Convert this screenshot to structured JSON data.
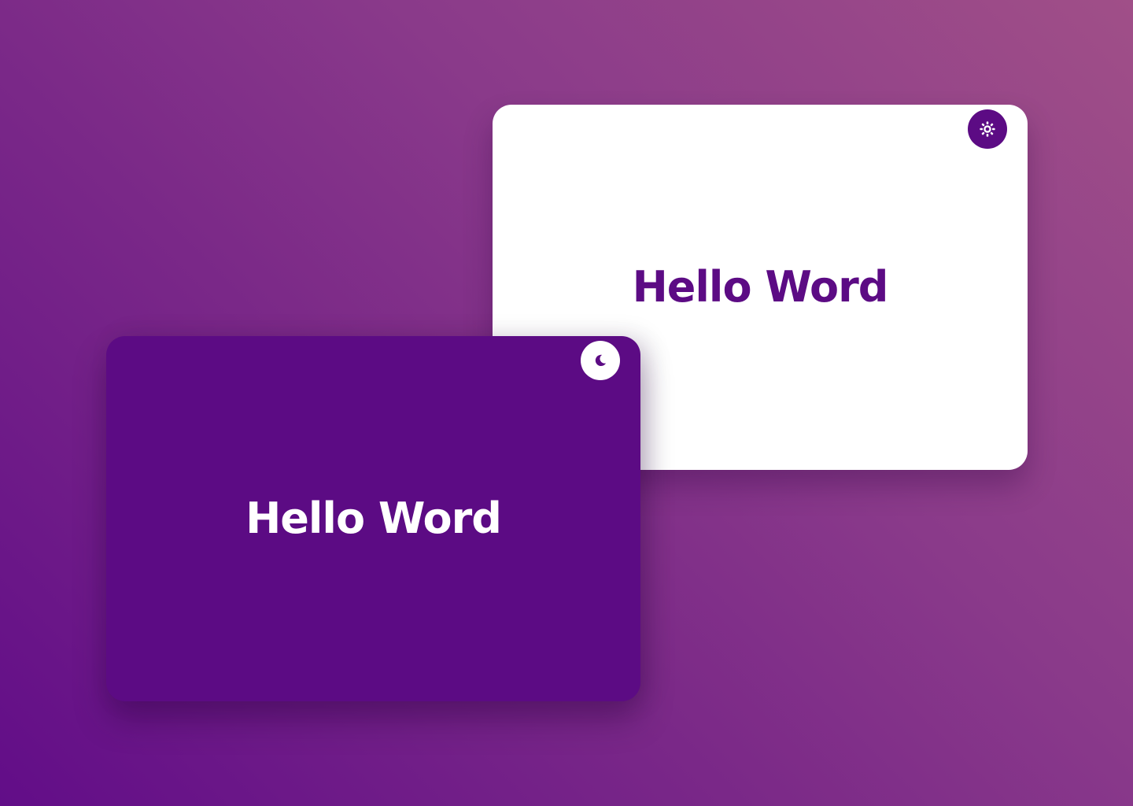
{
  "cards": {
    "light": {
      "title": "Hello Word",
      "toggle_icon": "sun-icon",
      "background": "#ffffff",
      "text_color": "#5c0b84"
    },
    "dark": {
      "title": "Hello Word",
      "toggle_icon": "moon-icon",
      "background": "#5c0b84",
      "text_color": "#ffffff"
    }
  },
  "colors": {
    "accent": "#5c0b84",
    "background_gradient_start": "#a04f88",
    "background_gradient_end": "#620d88"
  }
}
